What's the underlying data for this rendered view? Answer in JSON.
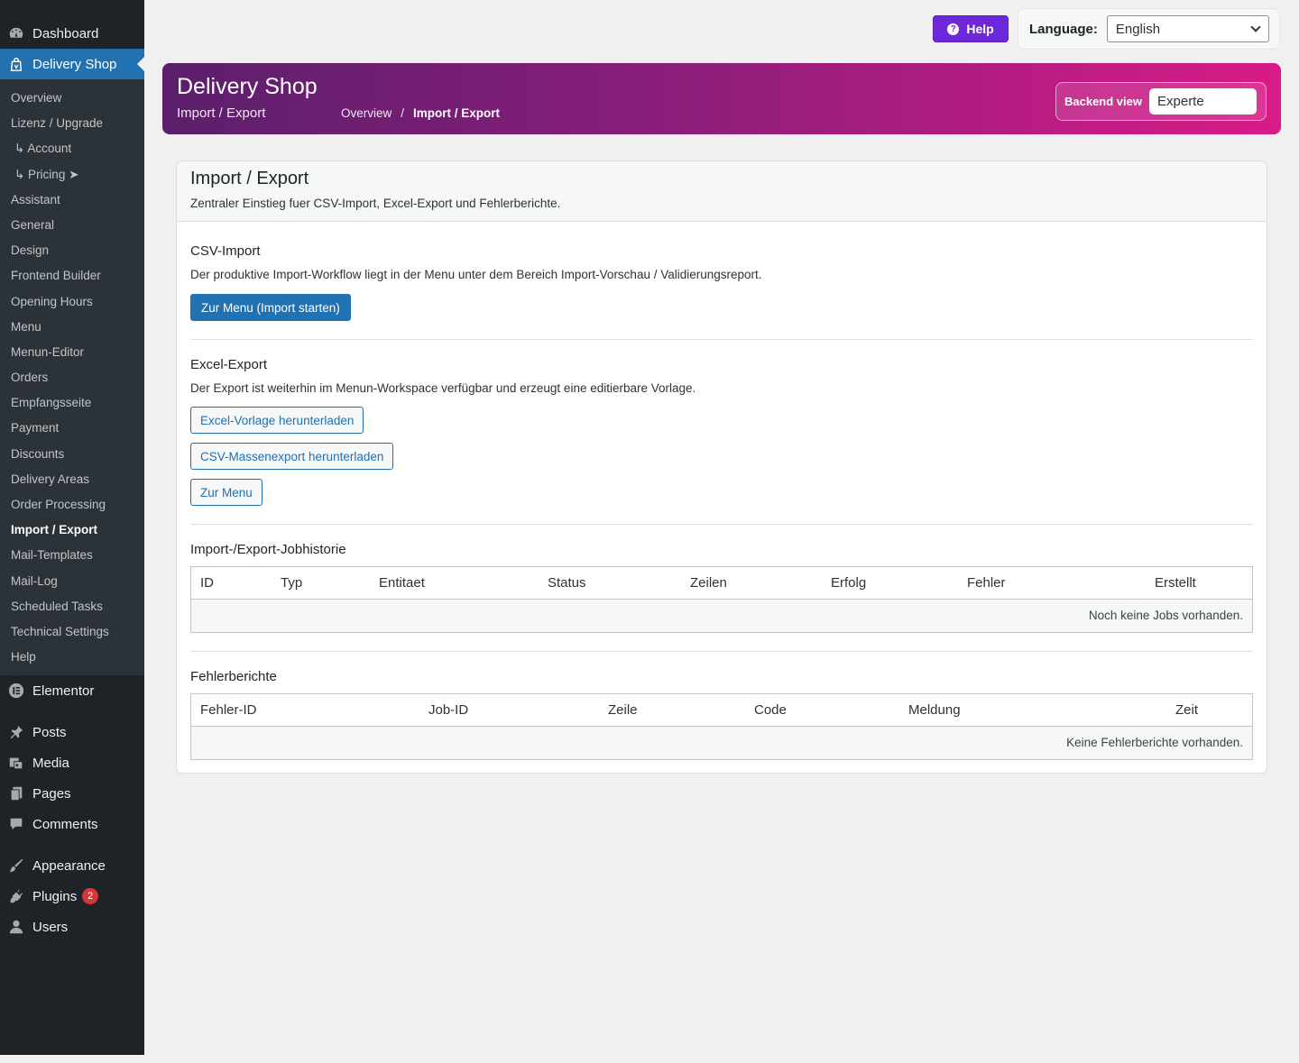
{
  "sidebar": {
    "top_items": [
      {
        "label": "Dashboard",
        "icon": "dashboard-icon"
      },
      {
        "label": "Delivery Shop",
        "icon": "shop-icon"
      }
    ],
    "sub_items": [
      "Overview",
      "Lizenz / Upgrade",
      "↳ Account",
      "↳ Pricing ➤",
      "Assistant",
      "General",
      "Design",
      "Frontend Builder",
      "Opening Hours",
      "Menu",
      "Menun-Editor",
      "Orders",
      "Empfangsseite",
      "Payment",
      "Discounts",
      "Delivery Areas",
      "Order Processing",
      "Import / Export",
      "Mail-Templates",
      "Mail-Log",
      "Scheduled Tasks",
      "Technical Settings",
      "Help"
    ],
    "lower_items": [
      {
        "label": "Elementor"
      },
      {
        "label": "Posts"
      },
      {
        "label": "Media"
      },
      {
        "label": "Pages"
      },
      {
        "label": "Comments"
      },
      {
        "label": "Appearance"
      },
      {
        "label": "Plugins",
        "badge": "2"
      },
      {
        "label": "Users"
      }
    ]
  },
  "topbar": {
    "help_label": "Help",
    "language_label": "Language:",
    "language_value": "English"
  },
  "banner": {
    "title": "Delivery Shop",
    "subtitle": "Import / Export",
    "breadcrumb_root": "Overview",
    "breadcrumb_sep": "/",
    "breadcrumb_current": "Import / Export",
    "backend_view_label": "Backend view",
    "backend_view_value": "Experte"
  },
  "card": {
    "title": "Import / Export",
    "description": "Zentraler Einstieg fuer CSV-Import, Excel-Export und Fehlerberichte.",
    "csv": {
      "title": "CSV-Import",
      "description": "Der produktive Import-Workflow liegt in der Menu unter dem Bereich Import-Vorschau / Validierungsreport.",
      "button": "Zur Menu (Import starten)"
    },
    "excel": {
      "title": "Excel-Export",
      "description": "Der Export ist weiterhin im Menun-Workspace verfügbar und erzeugt eine editierbare Vorlage.",
      "btn_template": "Excel-Vorlage herunterladen",
      "btn_mass": "CSV-Massenexport herunterladen",
      "btn_menu": "Zur Menu"
    },
    "jobs": {
      "title": "Import-/Export-Jobhistorie",
      "columns": [
        "ID",
        "Typ",
        "Entitaet",
        "Status",
        "Zeilen",
        "Erfolg",
        "Fehler",
        "Erstellt"
      ],
      "empty": "Noch keine Jobs vorhanden."
    },
    "errors": {
      "title": "Fehlerberichte",
      "columns": [
        "Fehler-ID",
        "Job-ID",
        "Zeile",
        "Code",
        "Meldung",
        "Zeit"
      ],
      "empty": "Keine Fehlerberichte vorhanden."
    }
  }
}
